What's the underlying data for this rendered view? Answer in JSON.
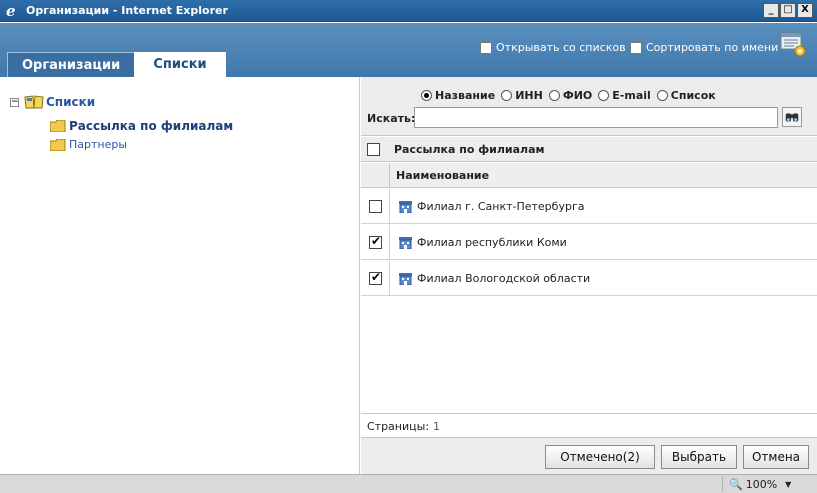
{
  "window": {
    "title": "Организации - Internet Explorer",
    "buttons": [
      "_",
      "□",
      "X"
    ]
  },
  "header": {
    "option_open_from_lists": "Открывать со списков",
    "option_sort_by_name": "Сортировать по имени",
    "tabs": [
      {
        "label": "Организации",
        "active": false
      },
      {
        "label": "Списки",
        "active": true
      }
    ]
  },
  "tree": {
    "root": {
      "label": "Списки",
      "icon": "book-icon",
      "expanded": true
    },
    "children": [
      {
        "label": "Рассылка по филиалам",
        "icon": "folder-icon",
        "selected": true
      },
      {
        "label": "Партнеры",
        "icon": "folder-icon",
        "selected": false
      }
    ]
  },
  "search": {
    "radio_options": [
      {
        "label": "Название",
        "selected": true
      },
      {
        "label": "ИНН",
        "selected": false
      },
      {
        "label": "ФИО",
        "selected": false
      },
      {
        "label": "E-mail",
        "selected": false
      },
      {
        "label": "Список",
        "selected": false
      }
    ],
    "label": "Искать:",
    "value": ""
  },
  "grid": {
    "title": "Рассылка по филиалам",
    "column_header": "Наименование",
    "rows": [
      {
        "name": "Филиал г. Санкт-Петербурга",
        "checked": false
      },
      {
        "name": "Филиал республики Коми",
        "checked": true
      },
      {
        "name": "Филиал Вологодской области",
        "checked": true
      }
    ],
    "pages_label": "Страницы:",
    "pages_value": "1"
  },
  "footer": {
    "marked_label": "Отмечено(2)",
    "select_label": "Выбрать",
    "cancel_label": "Отмена"
  },
  "status": {
    "zoom": "100%"
  },
  "colors": {
    "titlebar": "#1d5a95",
    "header": "#4a82b4",
    "link": "#2b56a0"
  }
}
